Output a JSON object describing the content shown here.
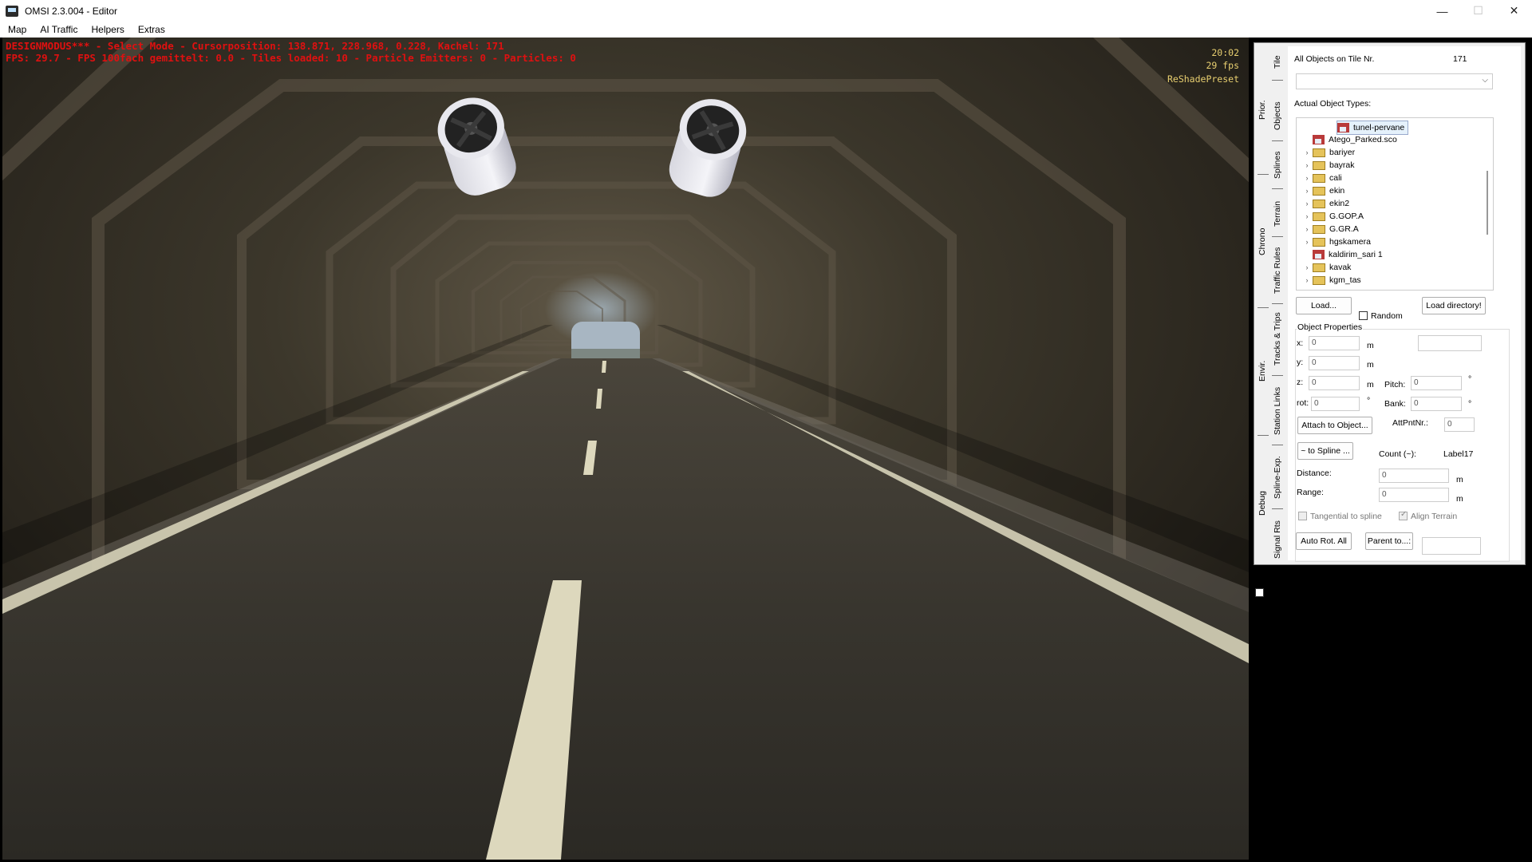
{
  "window": {
    "title": "OMSI 2.3.004 - Editor",
    "controls": [
      "—",
      "☐",
      "✕"
    ]
  },
  "menu": [
    "Map",
    "AI Traffic",
    "Helpers",
    "Extras"
  ],
  "hud": {
    "line1": "DESIGNMODUS*** - Select Mode - Cursorposition: 138.871, 228.968, 0.228, Kachel: 171",
    "line2": "FPS: 29.7 - FPS 100fach gemittelt: 0.0 - Tiles loaded: 10 - Particle Emitters: 0 - Particles: 0",
    "time": "20:02",
    "fps": "29 fps",
    "preset": "ReShadePreset"
  },
  "tabs_outer": [
    "Prior.",
    "Chrono",
    "Envir.",
    "Debug"
  ],
  "tabs_inner": [
    "Tile",
    "Objects",
    "Splines",
    "Terrain",
    "Traffic Rules",
    "Tracks & Trips",
    "Station Links",
    "Spline-Exp.",
    "Signal Rts"
  ],
  "panel": {
    "tile_label": "All Objects on Tile Nr.",
    "tile_number": "171",
    "combo_value": "",
    "types_label": "Actual Object Types:",
    "tree": [
      {
        "label": "tunel-pervane",
        "icon": "house-icon",
        "expand": "",
        "selected": true
      },
      {
        "label": "Atego_Parked.sco",
        "icon": "house-icon",
        "expand": ""
      },
      {
        "label": "bariyer",
        "icon": "folder-icon",
        "expand": "›"
      },
      {
        "label": "bayrak",
        "icon": "folder-icon",
        "expand": "›"
      },
      {
        "label": "cali",
        "icon": "folder-icon",
        "expand": "›"
      },
      {
        "label": "ekin",
        "icon": "folder-icon",
        "expand": "›"
      },
      {
        "label": "ekin2",
        "icon": "folder-icon",
        "expand": "›"
      },
      {
        "label": "G.GOP.A",
        "icon": "folder-icon",
        "expand": "›"
      },
      {
        "label": "G.GR.A",
        "icon": "folder-icon",
        "expand": "›"
      },
      {
        "label": "hgskamera",
        "icon": "folder-icon",
        "expand": "›"
      },
      {
        "label": "kaldirim_sari 1",
        "icon": "house-icon",
        "expand": ""
      },
      {
        "label": "kavak",
        "icon": "folder-icon",
        "expand": "›"
      },
      {
        "label": "kgm_tas",
        "icon": "folder-icon",
        "expand": "›"
      }
    ],
    "load_button": "Load...",
    "random_label": "Random",
    "load_dir_button": "Load directory!",
    "props_title": "Object Properties",
    "x_label": "x:",
    "x_value": "0",
    "y_label": "y:",
    "y_value": "0",
    "z_label": "z:",
    "z_value": "0",
    "rot_label": "rot:",
    "rot_value": "0",
    "unit_m": "m",
    "unit_deg": "°",
    "pitch_label": "Pitch:",
    "pitch_value": "0",
    "bank_label": "Bank:",
    "bank_value": "0",
    "attach_button": "Attach to Object...",
    "attpnt_label": "AttPntNr.:",
    "attpnt_value": "0",
    "to_spline_button": "~ to Spline ...",
    "count_label": "Count (~):",
    "count_value": "Label17",
    "distance_label": "Distance:",
    "distance_value": "0",
    "range_label": "Range:",
    "range_value": "0",
    "tangential_label": "Tangential to spline",
    "align_label": "Align Terrain",
    "autorot_button": "Auto Rot. All",
    "parent_button": "Parent to...:"
  }
}
